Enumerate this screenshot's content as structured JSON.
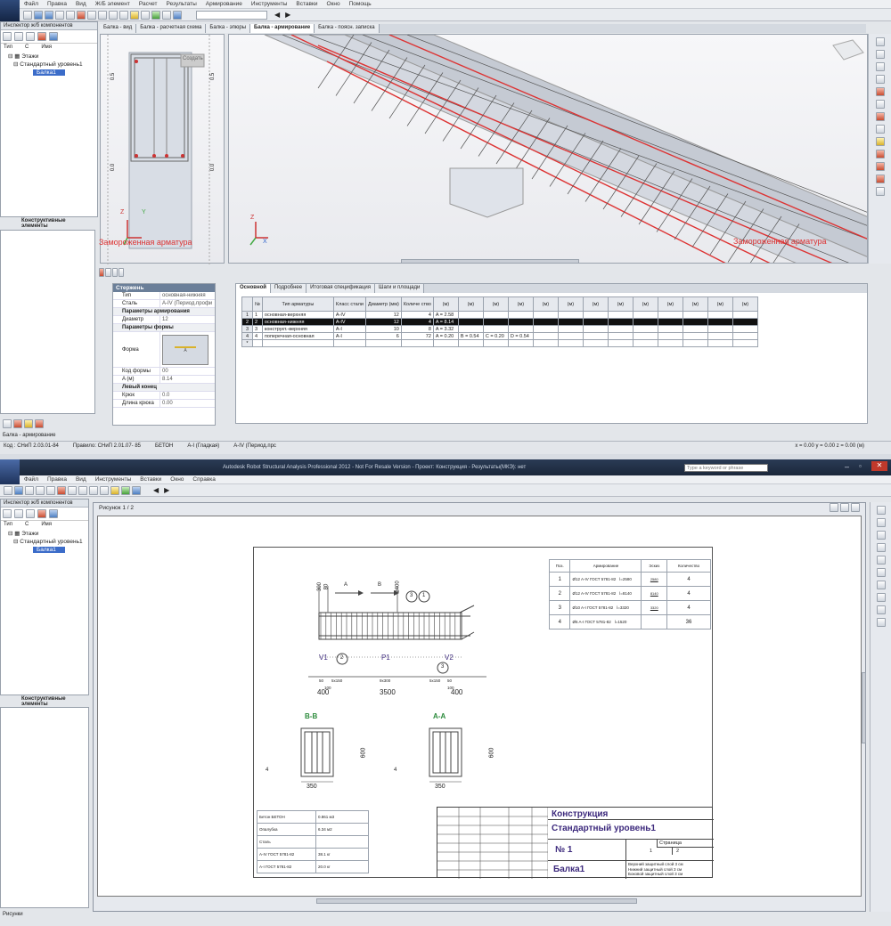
{
  "top": {
    "menu": [
      "Файл",
      "Правка",
      "Вид",
      "Ж/Б элемент",
      "Расчет",
      "Результаты",
      "Армирование",
      "Инструменты",
      "Вставки",
      "Окно",
      "Помощь"
    ],
    "inspector_title": "Инспектор ж/б компонентов",
    "tree_headers": [
      "Тип",
      "С",
      "Имя"
    ],
    "tree": [
      "Этажи",
      "Стандартный уровень1",
      "Балка1"
    ],
    "tree_bottom_tab": "Конструктивные элементы",
    "view_tabs": [
      "Балка - вид",
      "Балка - расчетная схема",
      "Балка - эпюры",
      "Балка - армирование",
      "Балка - поясн. записка"
    ],
    "active_tab_index": 3,
    "left_view_label": "Замороженная арматура",
    "right_view_label": "Замороженная арматура",
    "axis_z": "Z",
    "axis_y": "Y",
    "axis_x": "X",
    "ruler_ticks": [
      "0.5",
      "0.0",
      "0.5",
      "0.0"
    ],
    "section_tag": "Создать",
    "props": {
      "header": "Стержень",
      "rows": [
        {
          "k": "Тип",
          "v": "основная-нижняя"
        },
        {
          "k": "Сталь",
          "v": "A-IV (Период.профи"
        },
        {
          "k": "Параметры армирования",
          "v": ""
        },
        {
          "k": "Диаметр",
          "v": "12"
        },
        {
          "k": "Параметры формы",
          "v": ""
        },
        {
          "k": "Форма",
          "v": ""
        },
        {
          "k": "Код формы",
          "v": "00"
        },
        {
          "k": "A (м)",
          "v": "8.14"
        },
        {
          "k": "Левый конец",
          "v": ""
        },
        {
          "k": "Крюк",
          "v": "0.0"
        },
        {
          "k": "Длина крюка",
          "v": "0.00"
        }
      ],
      "shape_label": "A"
    },
    "spec_tabs": [
      "Основной",
      "Подробнее",
      "Итоговая спецификация",
      "Шаги и площади"
    ],
    "spec_headers": [
      "№",
      "Тип арматуры",
      "Класс стали",
      "Диаметр (мм)",
      "Количе ство",
      "(м)",
      "(м)",
      "(м)",
      "(м)",
      "(м)",
      "(м)",
      "(м)",
      "(м)",
      "(м)",
      "(м)",
      "(м)",
      "(м)",
      "(м)"
    ],
    "spec_rows": [
      {
        "n": "1",
        "idx": "1",
        "type": "основная-верхняя",
        "cls": "A-IV",
        "d": "12",
        "q": "4",
        "a": "A = 2.58",
        "b": "",
        "c": "",
        "dd": ""
      },
      {
        "n": "2",
        "idx": "2",
        "type": "основная-нижняя",
        "cls": "A-IV",
        "d": "12",
        "q": "4",
        "a": "A = 8.14",
        "b": "",
        "c": "",
        "dd": ""
      },
      {
        "n": "3",
        "idx": "3",
        "type": "конструкт.-верхняя",
        "cls": "A-I",
        "d": "10",
        "q": "8",
        "a": "A = 3.32",
        "b": "",
        "c": "",
        "dd": ""
      },
      {
        "n": "4",
        "idx": "4",
        "type": "поперечная-основная",
        "cls": "A-I",
        "d": "6",
        "q": "72",
        "a": "A = 0.20",
        "b": "B = 0.54",
        "c": "C = 0.20",
        "dd": "D = 0.54"
      },
      {
        "n": "*",
        "idx": "",
        "type": "",
        "cls": "",
        "d": "",
        "q": "",
        "a": "",
        "b": "",
        "c": "",
        "dd": ""
      }
    ],
    "status_title": "Балка - армирование",
    "status": [
      "Код : СНиП 2.03.01-84",
      "Правило: СНиП 2.01.07- 85",
      "БЕТОН",
      "A-I (Гладкая)",
      "A-IV (Период.прс"
    ],
    "coords": "x = 0.00  y = 0.00  z = 0.00   (м)"
  },
  "bottom": {
    "window_title": "Autodesk Robot Structural Analysis Professional 2012 - Not For Resale Version - Проект: Конструкция - Результаты(МКЭ): нет",
    "search_placeholder": "Type a keyword or phrase",
    "menu": [
      "Файл",
      "Правка",
      "Вид",
      "Инструменты",
      "Вставки",
      "Окно",
      "Справка"
    ],
    "inspector_title": "Инспектор ж/б компонентов",
    "tree_headers": [
      "Тип",
      "С",
      "Имя"
    ],
    "tree": [
      "Этажи",
      "Стандартный уровень1",
      "Балка1"
    ],
    "tree_bottom_tab": "Конструктивные элементы",
    "sheet_title": "Рисунок 1 / 2",
    "status_title": "Рисунки",
    "drawing": {
      "dims_top": [
        "300",
        "80",
        "2400"
      ],
      "labels_ab": [
        "A",
        "B"
      ],
      "callouts": [
        "1",
        "2",
        "3",
        "4"
      ],
      "span_labels": [
        "V1",
        "P1",
        "V2"
      ],
      "dim_bottom": [
        "400",
        "3500",
        "400"
      ],
      "small_dims": [
        "50",
        "5х150",
        "9х300",
        "5х150",
        "50",
        "100",
        "100"
      ],
      "sec_b": "B-B",
      "sec_a": "A-A",
      "sec_height": "600",
      "sec_width": "350",
      "spec_headers": [
        "Поз.",
        "Армирование",
        "Эскиз",
        "Количество"
      ],
      "spec_rows": [
        {
          "pos": "1",
          "arm": "Ø12 A-IV ГОСТ 5781-82",
          "l": "l=2580",
          "sk": "2580",
          "q": "4"
        },
        {
          "pos": "2",
          "arm": "Ø12 A-IV ГОСТ 5781-82",
          "l": "l=8140",
          "sk": "8140",
          "q": "4"
        },
        {
          "pos": "3",
          "arm": "Ø10 A-I ГОСТ 5781-82",
          "l": "l=3320",
          "sk": "3320",
          "q": "4"
        },
        {
          "pos": "4",
          "arm": "Ø6 A-I ГОСТ 5781-82",
          "l": "l=1520",
          "sk": "",
          "q": "36"
        }
      ],
      "mat_rows": [
        {
          "k": "Бетон БЕТОН",
          "v": "0.861 м3"
        },
        {
          "k": "Опалубка",
          "v": "6.34 м2"
        },
        {
          "k": "Сталь",
          "v": ""
        },
        {
          "k": "A-IV ГОСТ 5781-82",
          "v": "38.1  кг"
        },
        {
          "k": "A-I ГОСТ 5781-82",
          "v": "20.0  кг"
        }
      ],
      "title_block": {
        "project": "Конструкция",
        "level": "Стандартный уровень1",
        "num": "№ 1",
        "element": "Балка1",
        "page_label": "Страница",
        "pages": [
          "1",
          "2"
        ],
        "notes": [
          "Верхний защитный слой 3 см",
          "Нижний защитный слой 3 см",
          "Боковой защитный слой 3 см"
        ]
      }
    }
  }
}
